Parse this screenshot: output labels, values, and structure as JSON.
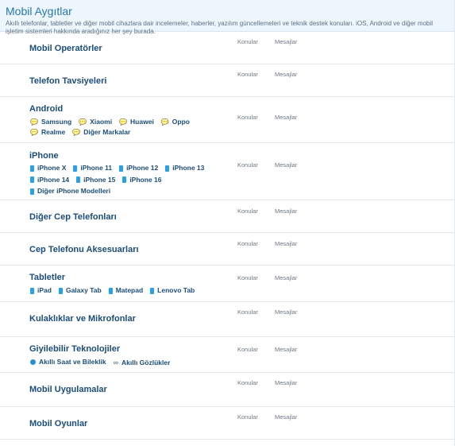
{
  "header": {
    "title": "Mobil Aygıtlar",
    "description": "Akıllı telefonlar, tabletler ve diğer mobil cihazlara dair incelemeler, haberler, yazılım güncellemeleri ve teknik destek konuları. iOS, Android ve diğer mobil işletim sistemleri hakkında aradığınız her şey burada."
  },
  "labels": {
    "topics": "Konular",
    "messages": "Mesajlar"
  },
  "forums": [
    {
      "title": "Mobil Operatörler"
    },
    {
      "title": "Telefon Tavsiyeleri"
    },
    {
      "title": "Android",
      "subs": [
        {
          "label": "Samsung",
          "icon": "chat-icon"
        },
        {
          "label": "Xiaomi",
          "icon": "chat-icon"
        },
        {
          "label": "Huawei",
          "icon": "chat-icon"
        },
        {
          "label": "Oppo",
          "icon": "chat-icon"
        },
        {
          "label": "Realme",
          "icon": "chat-icon"
        },
        {
          "label": "Diğer Markalar",
          "icon": "chat-icon"
        }
      ]
    },
    {
      "title": "iPhone",
      "subs": [
        {
          "label": "iPhone X",
          "icon": "phone-icon"
        },
        {
          "label": "iPhone 11",
          "icon": "phone-icon"
        },
        {
          "label": "iPhone 12",
          "icon": "phone-icon"
        },
        {
          "label": "iPhone 13",
          "icon": "phone-icon"
        },
        {
          "label": "iPhone 14",
          "icon": "phone-icon"
        },
        {
          "label": "iPhone 15",
          "icon": "phone-icon"
        },
        {
          "label": "iPhone 16",
          "icon": "phone-icon"
        },
        {
          "label": "Diğer iPhone Modelleri",
          "icon": "phone-icon"
        }
      ]
    },
    {
      "title": "Diğer Cep Telefonları"
    },
    {
      "title": "Cep Telefonu Aksesuarları"
    },
    {
      "title": "Tabletler",
      "subs": [
        {
          "label": "iPad",
          "icon": "phone-icon"
        },
        {
          "label": "Galaxy Tab",
          "icon": "phone-icon"
        },
        {
          "label": "Matepad",
          "icon": "phone-icon"
        },
        {
          "label": "Lenovo Tab",
          "icon": "phone-icon"
        }
      ]
    },
    {
      "title": "Kulaklıklar ve Mikrofonlar"
    },
    {
      "title": "Giyilebilir Teknolojiler",
      "subs": [
        {
          "label": "Akıllı Saat ve Bileklik",
          "icon": "watch-icon"
        },
        {
          "label": "Akıllı Gözlükler",
          "icon": "glasses-icon"
        }
      ]
    },
    {
      "title": "Mobil Uygulamalar"
    },
    {
      "title": "Mobil Oyunlar"
    }
  ]
}
